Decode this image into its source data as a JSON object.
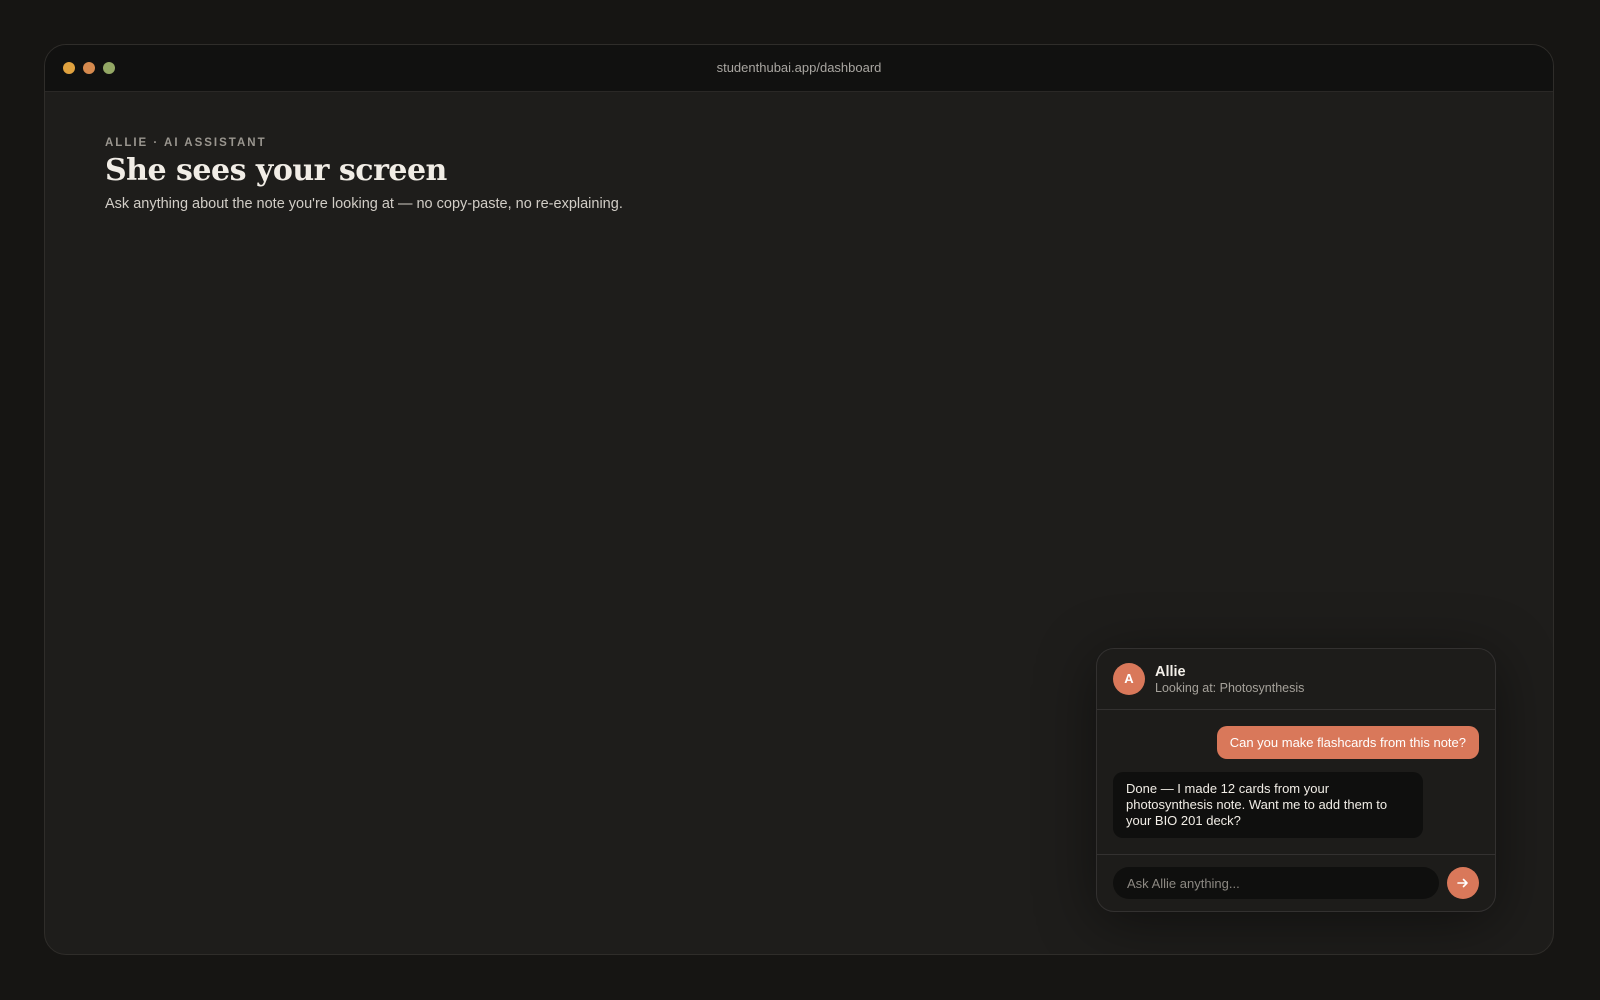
{
  "browser": {
    "url": "studenthubai.app/dashboard"
  },
  "hero": {
    "eyebrow": "ALLIE · AI ASSISTANT",
    "headline": "She sees your screen",
    "subheadline": "Ask anything about the note you're looking at — no copy-paste, no re-explaining."
  },
  "chat": {
    "avatar_letter": "A",
    "name": "Allie",
    "status": "Looking at: Photosynthesis",
    "messages": [
      {
        "role": "user",
        "text": "Can you make flashcards from this note?"
      },
      {
        "role": "assistant",
        "text": "Done — I made 12 cards from your photosynthesis note. Want me to add them to your BIO 201 deck?"
      }
    ],
    "input_placeholder": "Ask Allie anything...",
    "send_icon": "arrow-right-icon"
  },
  "colors": {
    "accent": "#d9785a",
    "window_bg": "#1e1d1b",
    "titlebar_bg": "#111110",
    "traffic_red": "#e0a23f",
    "traffic_yellow": "#d68a4e",
    "traffic_green": "#94a865"
  }
}
